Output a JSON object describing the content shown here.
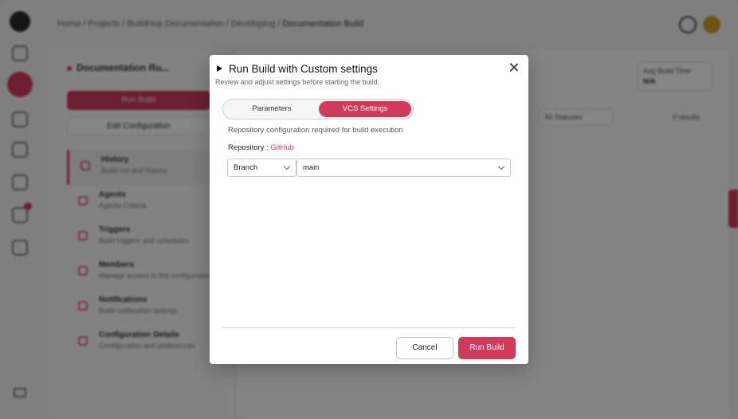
{
  "background": {
    "breadcrumb": [
      "Home",
      "Projects",
      "BuildHop Documentation",
      "Developing",
      "Documentation Build"
    ],
    "panel_title": "Documentation Ru...",
    "run_build_label": "Run Build",
    "edit_config_label": "Edit Configuration",
    "nav": [
      {
        "title": "History",
        "subtitle": "Build run and history"
      },
      {
        "title": "Agents",
        "subtitle": "Agents Criteria"
      },
      {
        "title": "Triggers",
        "subtitle": "Build triggers and schedules"
      },
      {
        "title": "Members",
        "subtitle": "Manage access to the configuration"
      },
      {
        "title": "Notifications",
        "subtitle": "Build notification settings"
      },
      {
        "title": "Configuration Details",
        "subtitle": "Configuration and preferences"
      }
    ],
    "avg_time_label": "Avg Build Time",
    "avg_time_value": "N/A",
    "filter_label": "All Statuses",
    "count_label": "0 results"
  },
  "modal": {
    "title": "Run Build with Custom settings",
    "subtitle": "Review and adjust settings before starting the build.",
    "tabs": [
      "Parameters",
      "VCS Settings"
    ],
    "active_tab": "VCS Settings",
    "description": "Repository configuration required for build execution",
    "repository_label": "Repository : ",
    "repository_value": "GitHub",
    "ref_type": "Branch",
    "ref_value": "main",
    "cancel_label": "Cancel",
    "run_label": "Run Build"
  },
  "colors": {
    "accent": "#d23a5c",
    "overlay": "rgba(0,0,0,0.48)"
  }
}
